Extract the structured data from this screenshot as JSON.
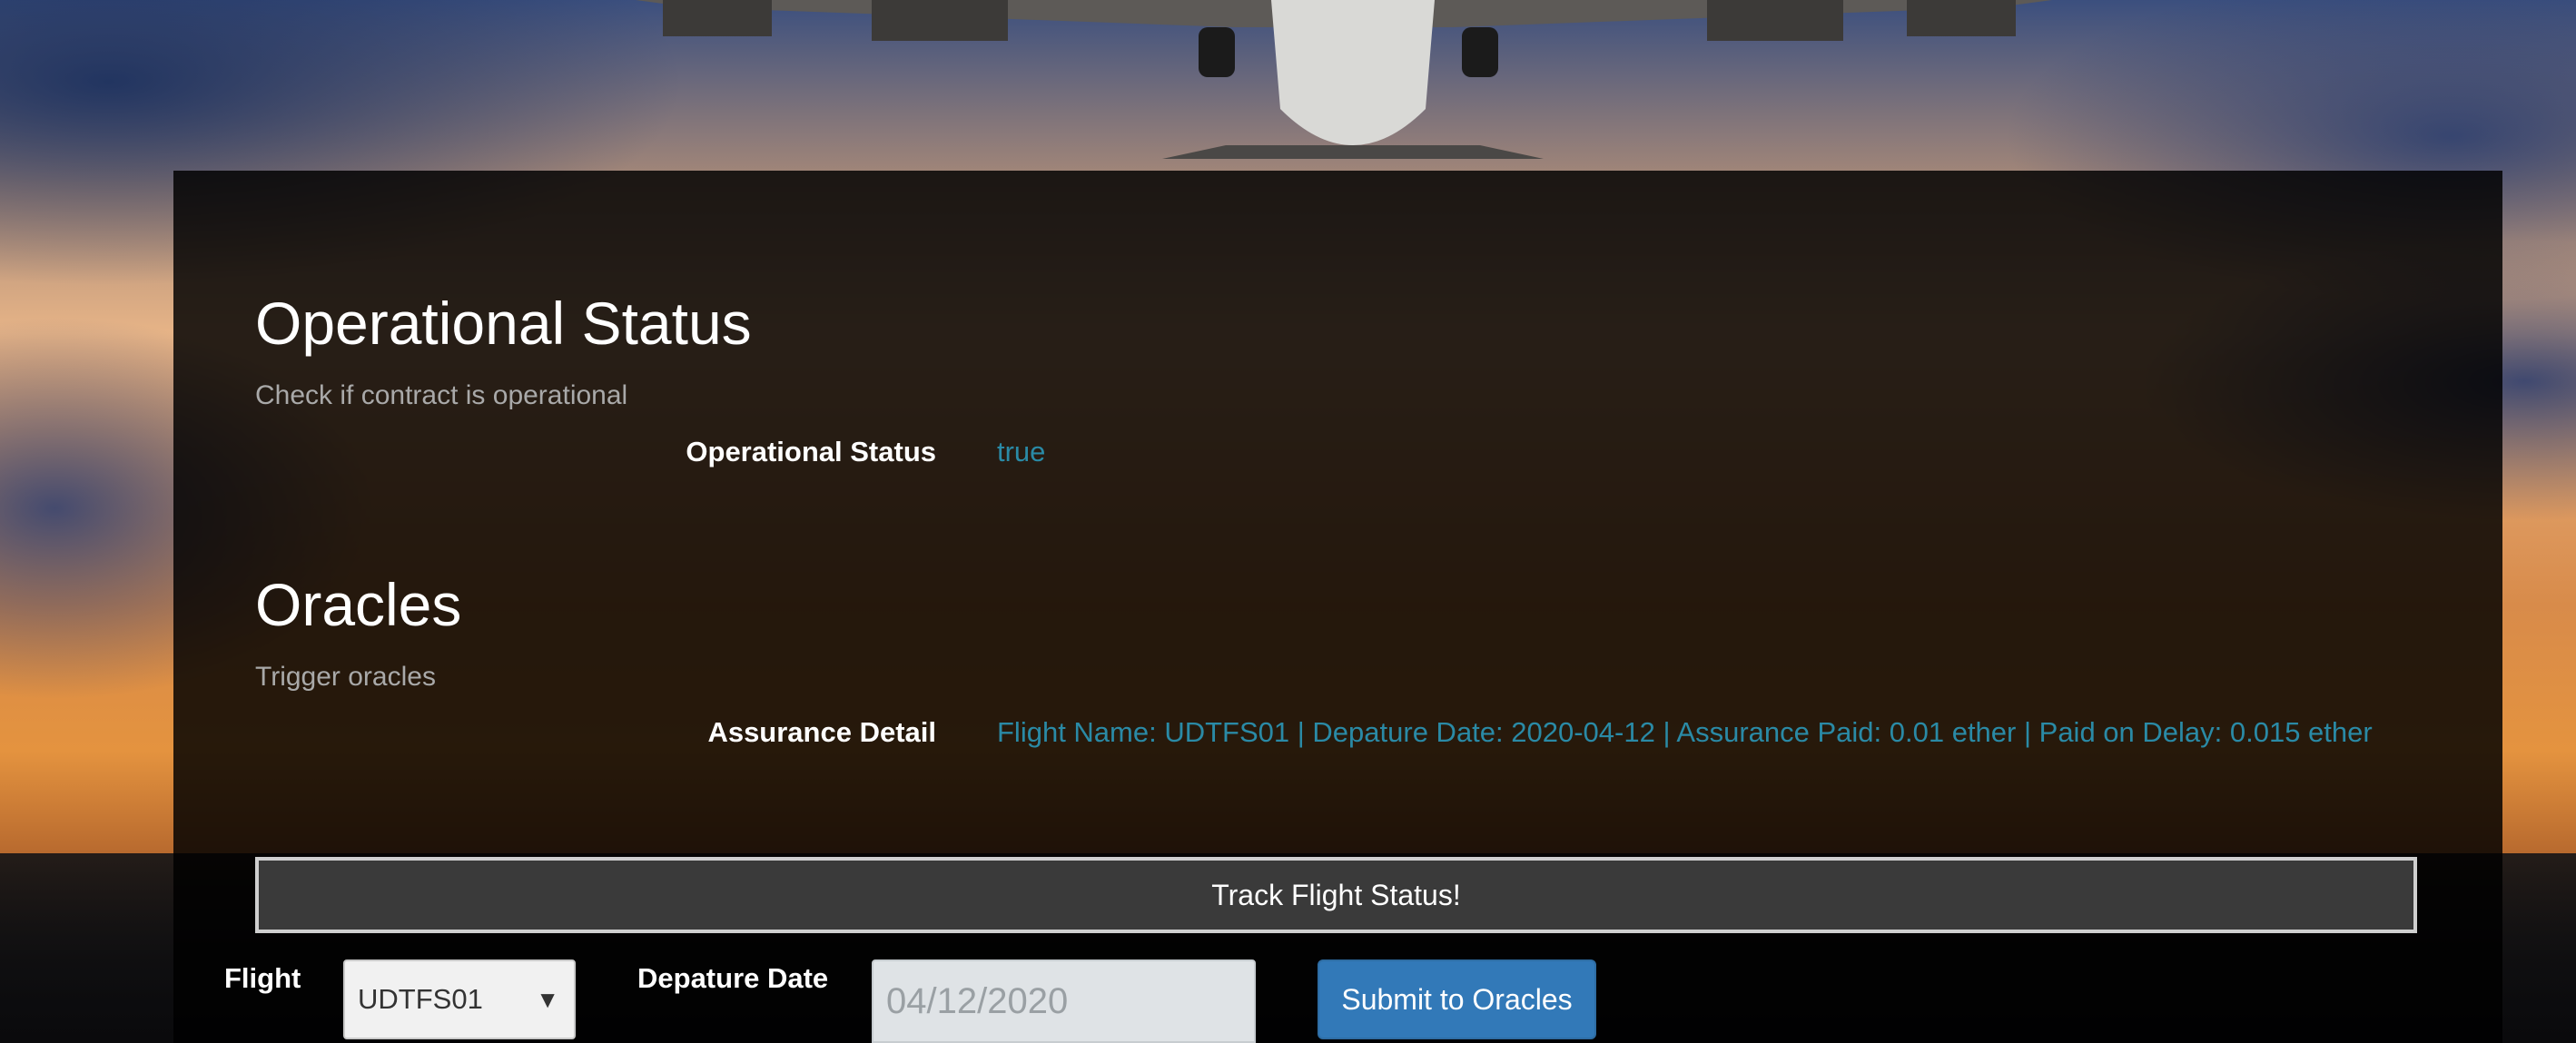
{
  "operational": {
    "title": "Operational Status",
    "subtitle": "Check if contract is operational",
    "label": "Operational Status",
    "value": "true"
  },
  "oracles": {
    "title": "Oracles",
    "subtitle": "Trigger oracles",
    "label": "Assurance Detail",
    "value": "Flight Name: UDTFS01 | Depature Date: 2020-04-12 | Assurance Paid: 0.01 ether | Paid on Delay: 0.015 ether"
  },
  "track_button": "Track Flight Status!",
  "form": {
    "flight_label": "Flight",
    "flight_selected": "UDTFS01",
    "date_label": "Depature Date",
    "date_value": "04/12/2020",
    "submit_label": "Submit to Oracles"
  },
  "colors": {
    "value_text": "#2a8aa6",
    "submit_button": "#3279b8"
  }
}
